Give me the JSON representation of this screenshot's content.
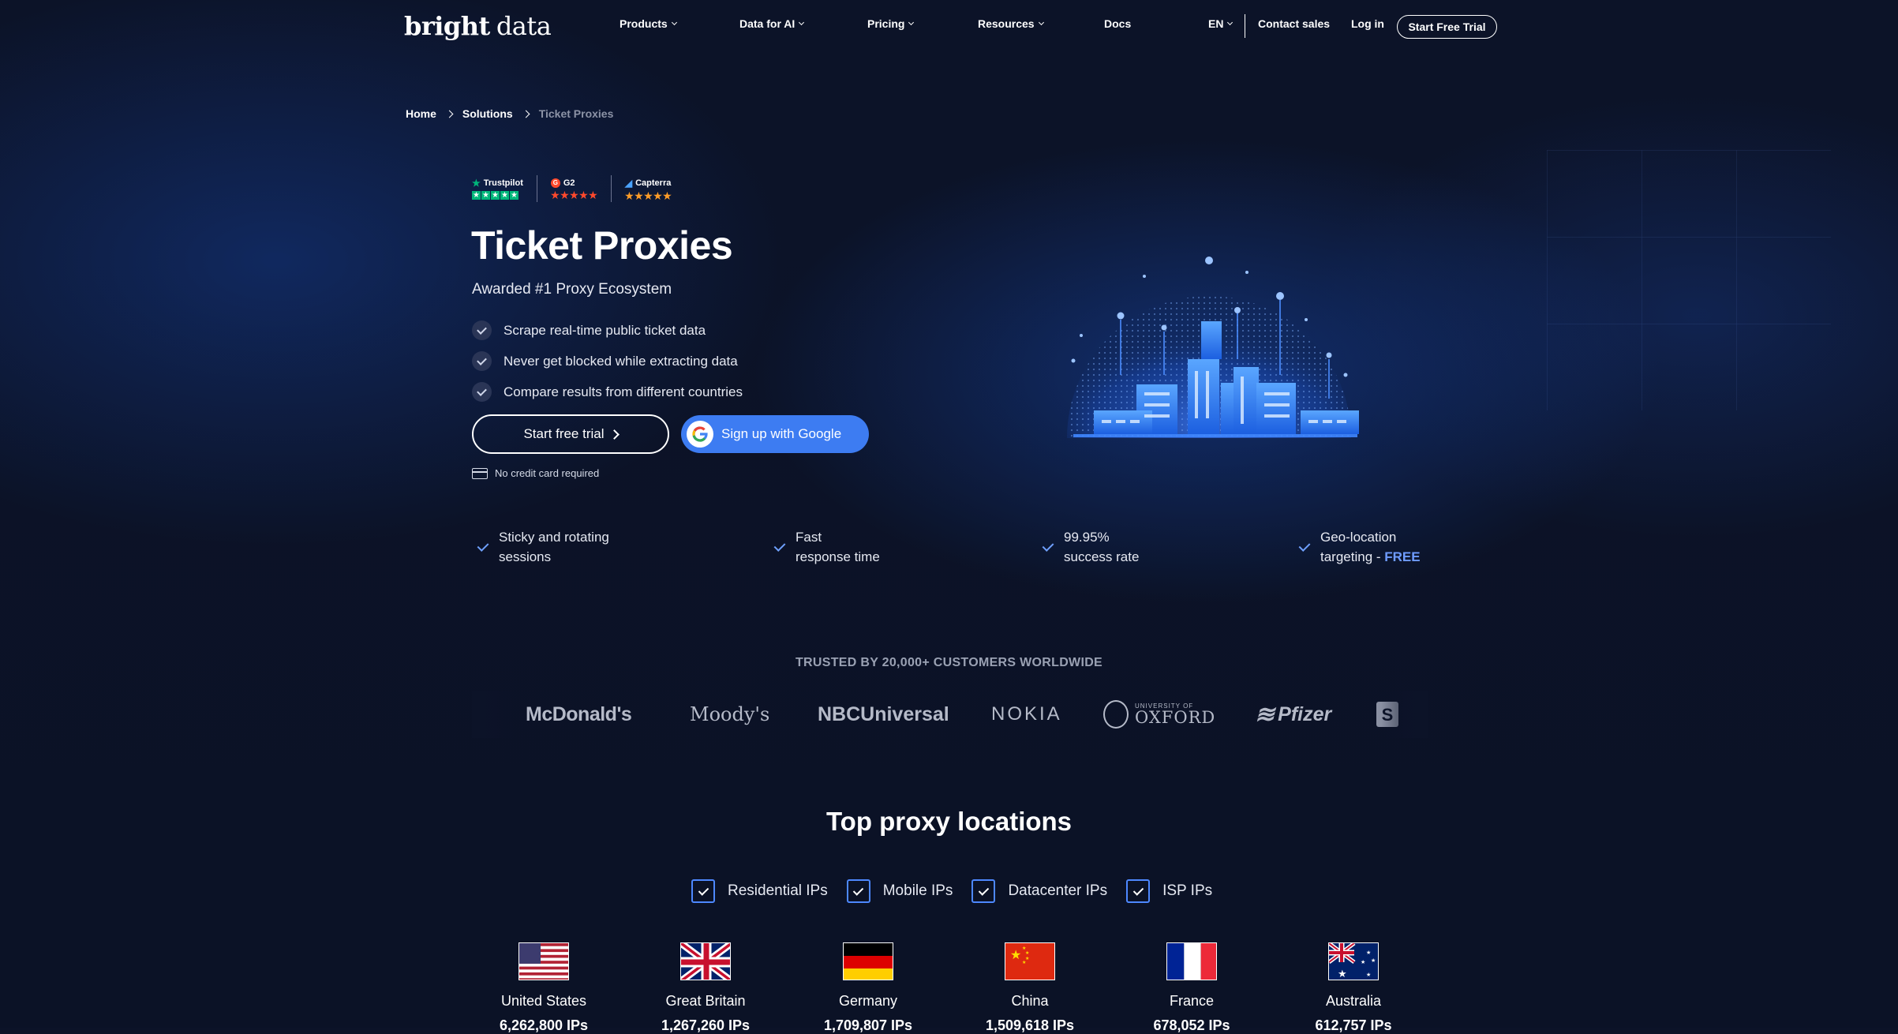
{
  "brand": {
    "logo_bold": "bright",
    "logo_light": "data"
  },
  "nav": {
    "items": [
      {
        "label": "Products"
      },
      {
        "label": "Data for AI"
      },
      {
        "label": "Pricing"
      },
      {
        "label": "Resources"
      },
      {
        "label": "Docs"
      }
    ],
    "language": "EN",
    "contact": "Contact sales",
    "login": "Log in",
    "trial": "Start Free Trial"
  },
  "breadcrumb": [
    "Home",
    "Solutions",
    "Ticket Proxies"
  ],
  "ratings": [
    {
      "name": "Trustpilot",
      "stars": 5
    },
    {
      "name": "G2",
      "stars": 5
    },
    {
      "name": "Capterra",
      "stars": 5
    }
  ],
  "hero": {
    "title": "Ticket Proxies",
    "subtitle": "Awarded  #1 Proxy Ecosystem",
    "features": [
      "Scrape real-time public ticket data",
      "Never get blocked while extracting data",
      "Compare results from different countries"
    ],
    "cta_trial": "Start free trial",
    "cta_google": "Sign up with Google",
    "no_card": "No credit card required"
  },
  "benefits": [
    {
      "line1": "Sticky and rotating",
      "line2": "sessions",
      "extra": ""
    },
    {
      "line1": "Fast",
      "line2": "response time",
      "extra": ""
    },
    {
      "line1": "99.95%",
      "line2": "success rate",
      "extra": ""
    },
    {
      "line1": "Geo-location",
      "line2": "targeting - ",
      "extra": "FREE"
    }
  ],
  "trusted": {
    "heading": "TRUSTED BY 20,000+ CUSTOMERS WORLDWIDE",
    "logos": [
      "McDonald's",
      "Moody's",
      "NBCUniversal",
      "NOKIA",
      "UNIVERSITY OF",
      "OXFORD",
      "Pfizer",
      "S"
    ]
  },
  "locations": {
    "title": "Top proxy locations",
    "filters": [
      "Residential IPs",
      "Mobile IPs",
      "Datacenter IPs",
      "ISP IPs"
    ],
    "countries": [
      {
        "name": "United States",
        "ips": "6,262,800 IPs"
      },
      {
        "name": "Great Britain",
        "ips": "1,267,260 IPs"
      },
      {
        "name": "Germany",
        "ips": "1,709,807 IPs"
      },
      {
        "name": "China",
        "ips": "1,509,618 IPs"
      },
      {
        "name": "France",
        "ips": "678,052 IPs"
      },
      {
        "name": "Australia",
        "ips": "612,757 IPs"
      }
    ]
  },
  "colors": {
    "background": "#0c1328",
    "accent": "#3d7cf2",
    "trustpilot": "#00b67a",
    "g2": "#ff492c",
    "capterra": "#ff9d28"
  }
}
